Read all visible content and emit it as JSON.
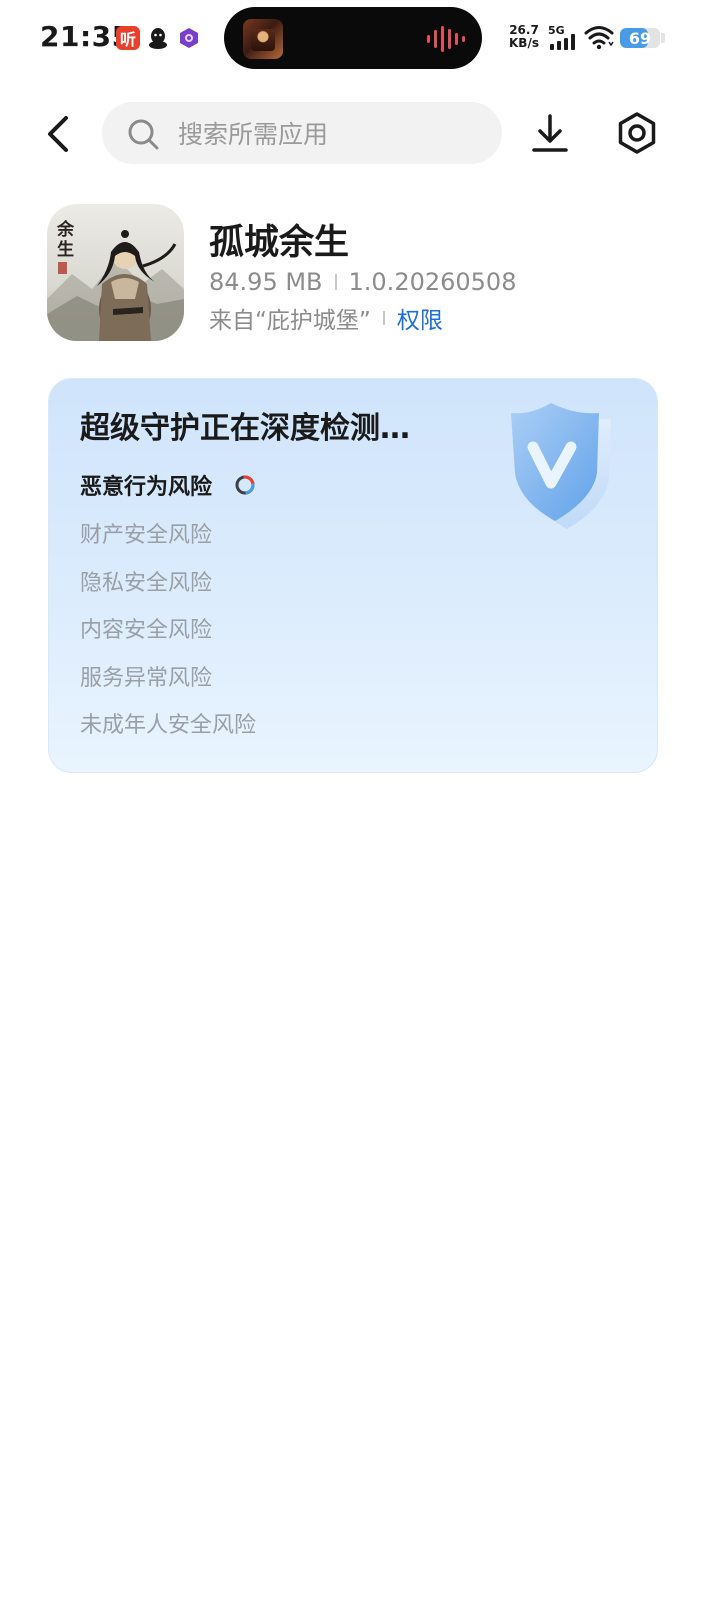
{
  "status_bar": {
    "time": "21:35",
    "listen_app_glyph": "听",
    "net_speed_value": "26.7",
    "net_speed_unit": "KB/s",
    "network_type": "5G",
    "battery_level": "69",
    "battery_fraction": 0.69,
    "icons": [
      "listen-app-icon",
      "qq-icon",
      "purple-app-icon",
      "signal-icon",
      "wifi-icon",
      "battery-icon",
      "sound-wave-icon"
    ]
  },
  "header": {
    "search_placeholder": "搜索所需应用",
    "icons": [
      "back-arrow-icon",
      "search-icon",
      "download-icon",
      "settings-icon"
    ]
  },
  "app": {
    "name": "孤城余生",
    "size": "84.95 MB",
    "version": "1.0.20260508",
    "source": "来自“庇护城堡”",
    "permission_link": "权限",
    "icon_text": "余生"
  },
  "scan": {
    "title": "超级守护正在深度检测…",
    "items": [
      {
        "label": "恶意行为风险",
        "state": "scanning"
      },
      {
        "label": "财产安全风险",
        "state": "pending"
      },
      {
        "label": "隐私安全风险",
        "state": "pending"
      },
      {
        "label": "内容安全风险",
        "state": "pending"
      },
      {
        "label": "服务异常风险",
        "state": "pending"
      },
      {
        "label": "未成年人安全风险",
        "state": "pending"
      }
    ]
  },
  "colors": {
    "accent_blue": "#1f6fd6",
    "card_gradient_top": "#cfe4fb",
    "card_gradient_bottom": "#e9f4fe",
    "listen_red": "#e8402d",
    "battery_blue": "#4a9be6"
  }
}
